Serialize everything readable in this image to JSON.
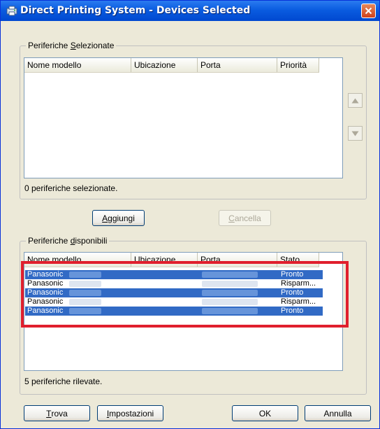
{
  "window": {
    "title": "Direct Printing System - Devices Selected"
  },
  "selected_group": {
    "legend_pre": "Periferiche ",
    "legend_key": "S",
    "legend_post": "elezionate",
    "columns": [
      "Nome modello",
      "Ubicazione",
      "Porta",
      "Priorità"
    ],
    "status": "0 periferiche selezionate."
  },
  "buttons": {
    "add": {
      "key": "A",
      "rest": "ggiungi"
    },
    "cancel": {
      "key": "C",
      "rest": "ancella"
    },
    "find": {
      "key": "T",
      "rest": "rova"
    },
    "settings": {
      "key": "I",
      "rest": "mpostazioni"
    },
    "ok": "OK",
    "cancel_dialog": "Annulla"
  },
  "available_group": {
    "legend_pre": "Periferiche ",
    "legend_key": "d",
    "legend_post": "isponibili",
    "columns": [
      "Nome modello",
      "Ubicazione",
      "Porta",
      "Stato"
    ],
    "rows": [
      {
        "name": "Panasonic",
        "status": "Pronto",
        "selected": true
      },
      {
        "name": "Panasonic",
        "status": "Risparm...",
        "selected": false
      },
      {
        "name": "Panasonic",
        "status": "Pronto",
        "selected": true
      },
      {
        "name": "Panasonic",
        "status": "Risparm...",
        "selected": false
      },
      {
        "name": "Panasonic",
        "status": "Pronto",
        "selected": true
      }
    ],
    "status": "5 periferiche rilevate."
  },
  "colors": {
    "selection": "#316ac5",
    "highlight_border": "#e01f2d",
    "titlebar": "#0a5ce0"
  },
  "icons": {
    "app": "printer-app-icon",
    "close": "close-icon",
    "up": "arrow-up-icon",
    "down": "arrow-down-icon"
  }
}
